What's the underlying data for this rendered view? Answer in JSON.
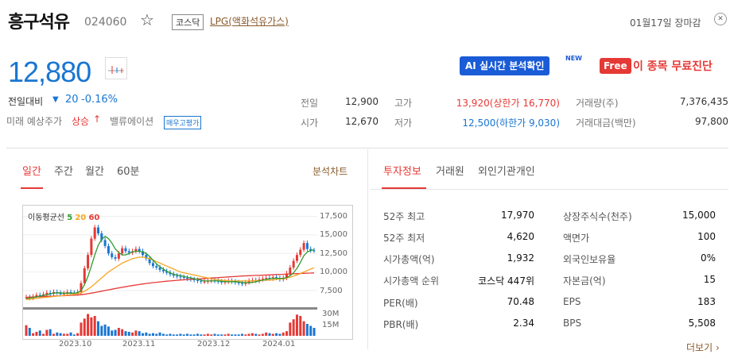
{
  "stock": {
    "name": "흥구석유",
    "code": "024060",
    "market": "코스닥",
    "category": "LPG(액화석유가스)",
    "date_text": "01월17일 장마감",
    "price": "12,880",
    "change_label": "전일대비",
    "change": "20",
    "change_pct": "-0.16%",
    "forecast_label": "미래 예상주가",
    "forecast_value": "상승",
    "valuation_label": "밸류에이션",
    "valuation_tag": "매우고평가"
  },
  "promo": {
    "ai_prefix": "AI",
    "ai_label": "실시간 분석확인",
    "new_tag": "NEW",
    "free_badge": "Free",
    "free_label": "이 종목 무료진단"
  },
  "quote": {
    "prev_label": "전일",
    "prev_value": "12,900",
    "high_label": "고가",
    "high_value": "13,920(상한가 16,770)",
    "volume_label": "거래량(주)",
    "volume_value": "7,376,435",
    "open_label": "시가",
    "open_value": "12,670",
    "low_label": "저가",
    "low_value": "12,500(하한가 9,030)",
    "amount_label": "거래대금(백만)",
    "amount_value": "97,800"
  },
  "chart_tabs": [
    "일간",
    "주간",
    "월간",
    "60분"
  ],
  "chart_link": "분석차트",
  "info_tabs": [
    "투자정보",
    "거래원",
    "외인기관개인"
  ],
  "chart_data": {
    "type": "candlestick",
    "legend_label": "이동평균선",
    "ma": [
      "5",
      "20",
      "60"
    ],
    "ma_colors": [
      "#2e9b2e",
      "#f5a623",
      "#e53935"
    ],
    "y_ticks": [
      "17,500",
      "15,000",
      "12,500",
      "10,000",
      "7,500"
    ],
    "y_values": [
      17500,
      15000,
      12500,
      10000,
      7500
    ],
    "vol_ticks": [
      "30M",
      "15M"
    ],
    "x_ticks": [
      "2023.10",
      "2023.11",
      "2023.12",
      "2024.01"
    ],
    "ylim": [
      5900,
      18300
    ],
    "close": [
      6600,
      6500,
      6700,
      6900,
      6800,
      7000,
      7200,
      7100,
      7300,
      7200,
      7000,
      7100,
      7300,
      7200,
      7100,
      7300,
      8500,
      10500,
      12300,
      14500,
      16000,
      15200,
      14300,
      13500,
      12500,
      12000,
      11800,
      12500,
      13200,
      12800,
      12600,
      12800,
      13100,
      12800,
      12300,
      11800,
      11200,
      10800,
      10600,
      10300,
      10100,
      9900,
      9700,
      9500,
      9400,
      9300,
      9200,
      9100,
      9000,
      8900,
      8800,
      8700,
      8700,
      8800,
      8900,
      8800,
      8700,
      8600,
      8700,
      8800,
      8700,
      8600,
      8500,
      8400,
      8600,
      8800,
      8900,
      8800,
      9000,
      9100,
      9200,
      9100,
      9300,
      9200,
      9000,
      9200,
      9800,
      10600,
      11500,
      12300,
      13000,
      13900,
      13100,
      12900,
      12880
    ],
    "ma5": [
      6400,
      6500,
      6550,
      6650,
      6750,
      6850,
      6950,
      7050,
      7150,
      7200,
      7200,
      7150,
      7150,
      7150,
      7150,
      7200,
      7500,
      8300,
      9400,
      10800,
      12300,
      13600,
      14400,
      14800,
      14500,
      13900,
      13100,
      12600,
      12300,
      12300,
      12500,
      12700,
      12800,
      12800,
      12700,
      12500,
      12100,
      11600,
      11100,
      10700,
      10400,
      10100,
      9900,
      9700,
      9600,
      9500,
      9400,
      9300,
      9200,
      9100,
      9000,
      8900,
      8800,
      8800,
      8800,
      8800,
      8800,
      8750,
      8700,
      8700,
      8700,
      8700,
      8650,
      8600,
      8550,
      8550,
      8600,
      8700,
      8800,
      8900,
      9000,
      9100,
      9150,
      9150,
      9150,
      9150,
      9250,
      9500,
      9900,
      10500,
      11300,
      12200,
      12700,
      12900,
      13000
    ],
    "ma20": [
      6300,
      6350,
      6400,
      6450,
      6500,
      6550,
      6600,
      6650,
      6700,
      6750,
      6800,
      6850,
      6900,
      6950,
      7000,
      7050,
      7200,
      7400,
      7700,
      8000,
      8400,
      8800,
      9200,
      9600,
      10000,
      10300,
      10600,
      10900,
      11200,
      11400,
      11600,
      11800,
      11900,
      12000,
      12000,
      11900,
      11800,
      11600,
      11400,
      11200,
      11000,
      10800,
      10600,
      10400,
      10200,
      10000,
      9900,
      9800,
      9700,
      9600,
      9500,
      9400,
      9300,
      9200,
      9100,
      9000,
      8950,
      8900,
      8850,
      8800,
      8800,
      8800,
      8800,
      8800,
      8800,
      8800,
      8800,
      8850,
      8850,
      8900,
      8900,
      8900,
      8950,
      9000,
      9050,
      9100,
      9200,
      9300,
      9450,
      9600,
      9800,
      10000,
      10200,
      10400,
      10550
    ],
    "ma60": [
      6600,
      6620,
      6640,
      6660,
      6680,
      6700,
      6720,
      6740,
      6760,
      6780,
      6800,
      6820,
      6840,
      6860,
      6880,
      6900,
      6950,
      7000,
      7080,
      7160,
      7240,
      7330,
      7420,
      7510,
      7600,
      7690,
      7780,
      7860,
      7940,
      8020,
      8100,
      8180,
      8250,
      8320,
      8390,
      8450,
      8510,
      8570,
      8620,
      8670,
      8720,
      8760,
      8800,
      8840,
      8880,
      8920,
      8950,
      8980,
      9010,
      9040,
      9070,
      9100,
      9130,
      9160,
      9190,
      9220,
      9250,
      9280,
      9310,
      9340,
      9370,
      9400,
      9430,
      9460,
      9480,
      9500,
      9520,
      9540,
      9560,
      9580,
      9600,
      9620,
      9640,
      9660,
      9680,
      9700,
      9720,
      9740,
      9760,
      9780,
      9800,
      9820,
      9840,
      9860,
      9880
    ],
    "volume": [
      16,
      12,
      4,
      6,
      8,
      3,
      9,
      10,
      3,
      5,
      4,
      3,
      3,
      5,
      2,
      4,
      20,
      26,
      33,
      28,
      30,
      22,
      15,
      17,
      14,
      8,
      9,
      12,
      10,
      7,
      6,
      5,
      8,
      7,
      4,
      5,
      3,
      4,
      3,
      5,
      3,
      2,
      3,
      2,
      2,
      3,
      2,
      3,
      2,
      2,
      3,
      2,
      2,
      3,
      2,
      3,
      2,
      2,
      2,
      3,
      2,
      2,
      2,
      3,
      2,
      3,
      4,
      3,
      2,
      3,
      5,
      4,
      3,
      4,
      3,
      5,
      7,
      20,
      25,
      32,
      30,
      22,
      18,
      15,
      12
    ]
  },
  "invest": {
    "left": [
      {
        "label": "52주 최고",
        "value": "17,970"
      },
      {
        "label": "52주 최저",
        "value": "4,620"
      },
      {
        "label": "시가총액(억)",
        "value": "1,932"
      },
      {
        "label": "시가총액 순위",
        "value": "코스닥 447위"
      },
      {
        "label": "PER(배)",
        "value": "70.48"
      },
      {
        "label": "PBR(배)",
        "value": "2.34"
      }
    ],
    "right": [
      {
        "label": "상장주식수(천주)",
        "value": "15,000"
      },
      {
        "label": "액면가",
        "value": "100"
      },
      {
        "label": "외국인보유율",
        "value": "0%"
      },
      {
        "label": "자본금(억)",
        "value": "15"
      },
      {
        "label": "EPS",
        "value": "183"
      },
      {
        "label": "BPS",
        "value": "5,508"
      }
    ],
    "more": "더보기"
  },
  "icons": {
    "star": "☆",
    "close": "✕",
    "up_arrow": "↑",
    "down_triangle": "▼",
    "chevron": "›"
  }
}
